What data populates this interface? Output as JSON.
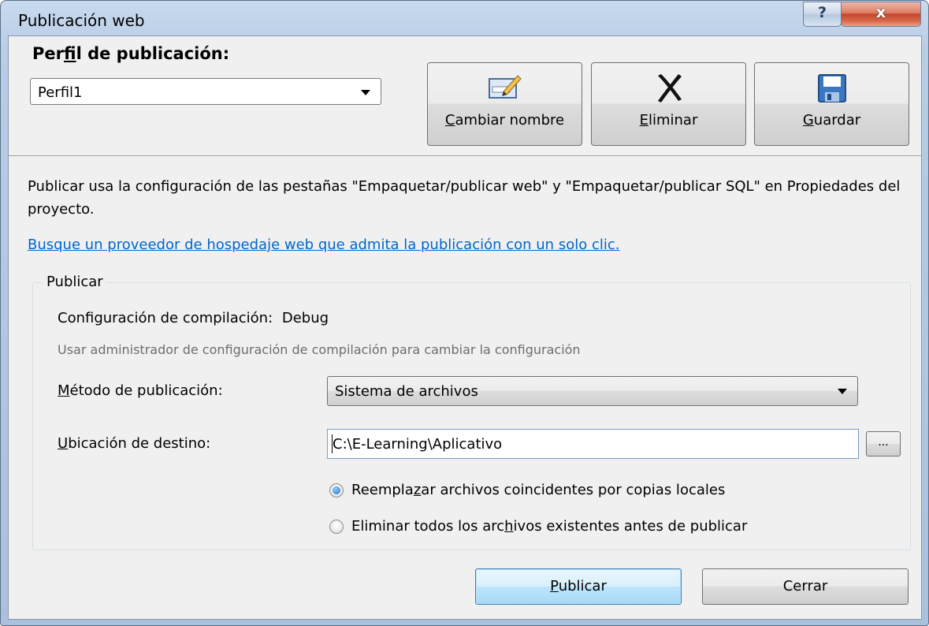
{
  "window": {
    "title": "Publicación web",
    "help_glyph": "?",
    "close_glyph": "x"
  },
  "profile": {
    "label_pre": "Per",
    "label_key": "f",
    "label_post": "il de publicación:",
    "selected": "Perfil1"
  },
  "toolbar": {
    "rename": {
      "key": "C",
      "rest": "ambiar nombre",
      "icon": "rename-icon"
    },
    "delete": {
      "key": "E",
      "rest": "liminar",
      "icon": "delete-x-icon"
    },
    "save": {
      "key": "G",
      "rest": "uardar",
      "icon": "floppy-disk-icon"
    }
  },
  "description": "Publicar usa la configuración de las pestañas \"Empaquetar/publicar web\" y \"Empaquetar/publicar SQL\" en Propiedades del proyecto.",
  "hosting_link": "Busque un proveedor de hospedaje web que admita la publicación con un solo clic.",
  "publish_group": {
    "title": "Publicar",
    "build_config_label": "Configuración de compilación:",
    "build_config_value": "Debug",
    "build_config_hint": "Usar administrador de configuración de compilación para cambiar la configuración",
    "method": {
      "label_key": "M",
      "label_rest": "étodo de publicación:",
      "selected": "Sistema de archivos"
    },
    "destination": {
      "label_key": "U",
      "label_rest": "bicación de destino:",
      "value": "C:\\E-Learning\\Aplicativo",
      "browse": "..."
    },
    "options": [
      {
        "pre": "Reempla",
        "key": "z",
        "post": "ar archivos coincidentes por copias locales",
        "checked": true
      },
      {
        "pre": "Eliminar todos los arc",
        "key": "h",
        "post": "ivos existentes antes de publicar",
        "checked": false
      }
    ]
  },
  "footer": {
    "publish_key": "P",
    "publish_rest": "ublicar",
    "close": "Cerrar"
  }
}
